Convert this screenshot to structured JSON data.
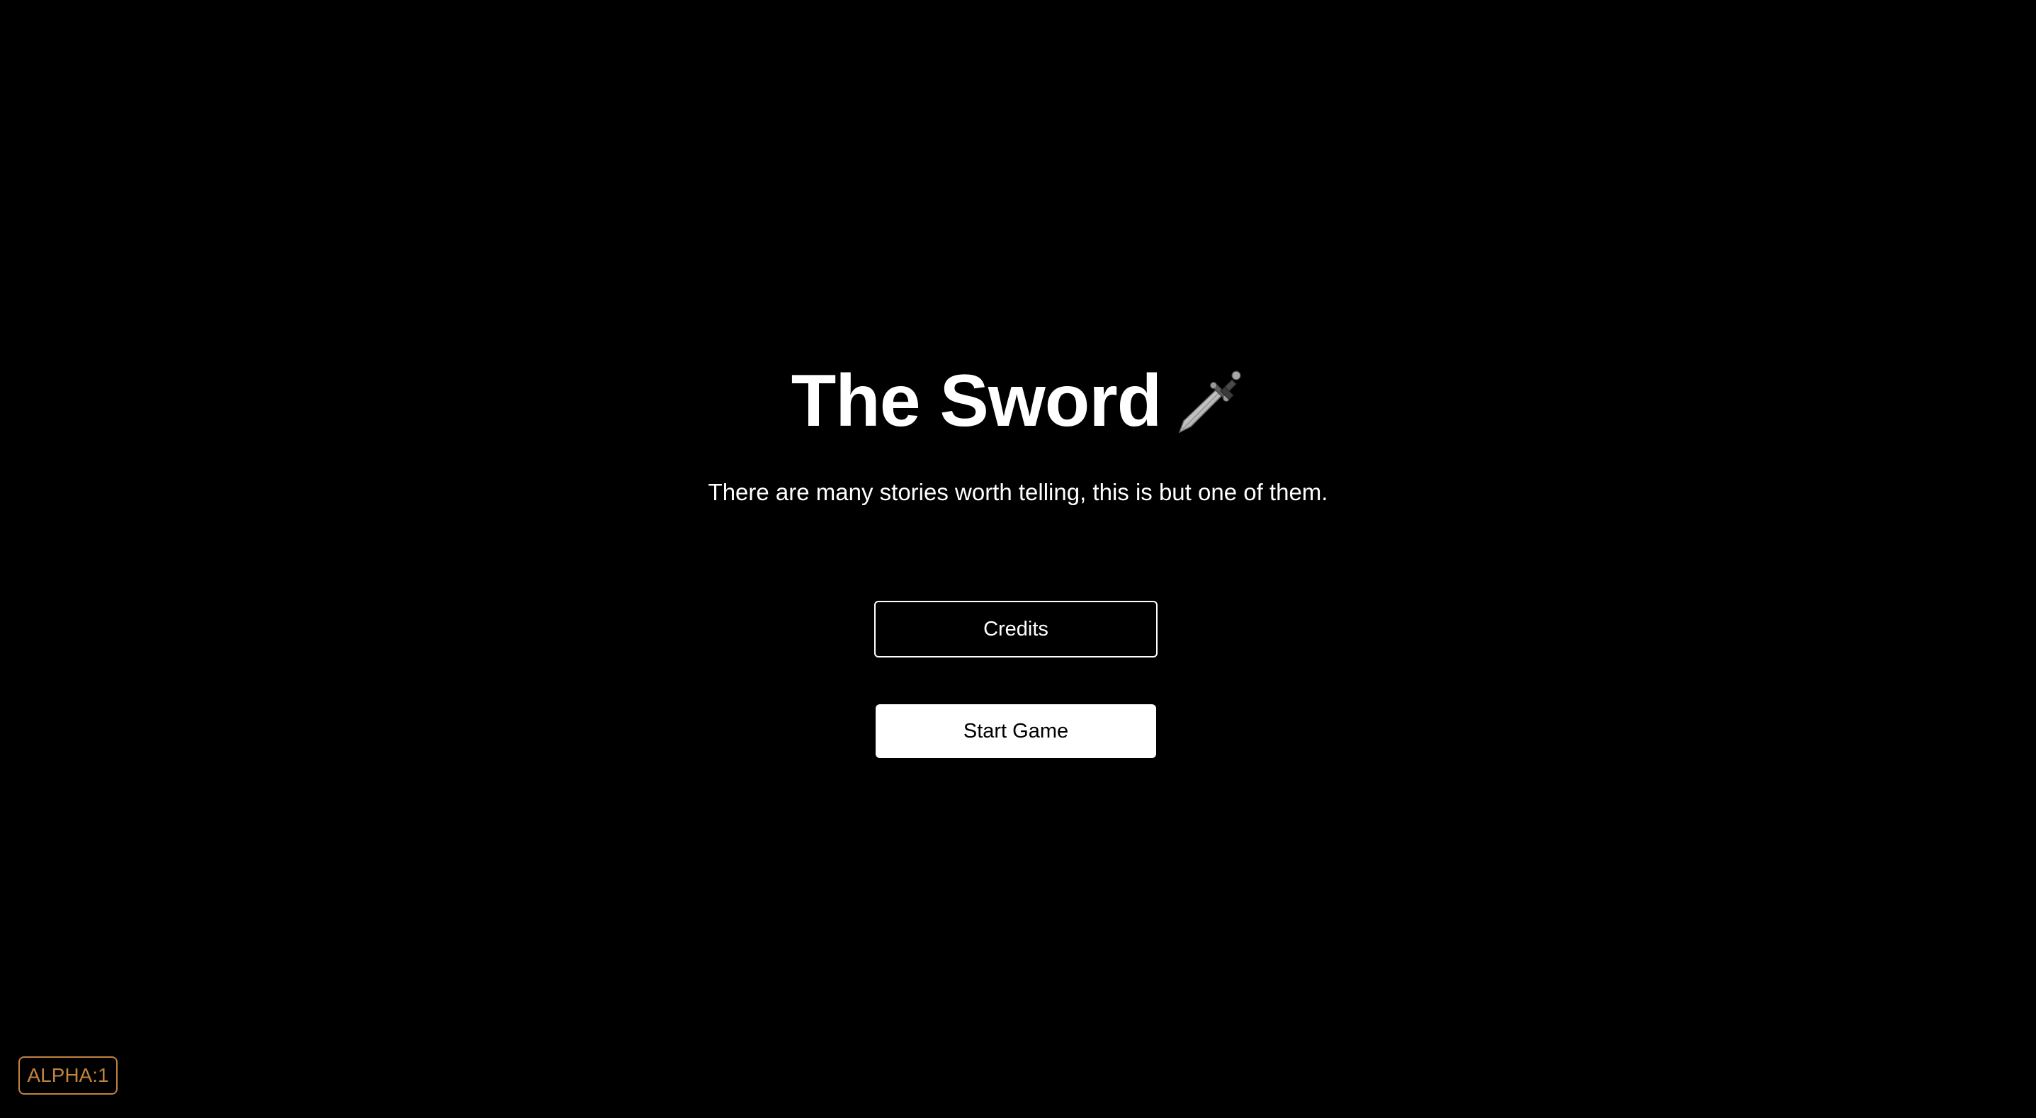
{
  "title": {
    "text": "The Sword",
    "icon": "dagger-icon"
  },
  "subtitle": "There are many stories worth telling, this is but one of them.",
  "menu": {
    "credits_label": "Credits",
    "start_label": "Start Game"
  },
  "version_badge": "ALPHA:1",
  "colors": {
    "background": "#000000",
    "text": "#ffffff",
    "badge_accent": "#c0843f"
  }
}
